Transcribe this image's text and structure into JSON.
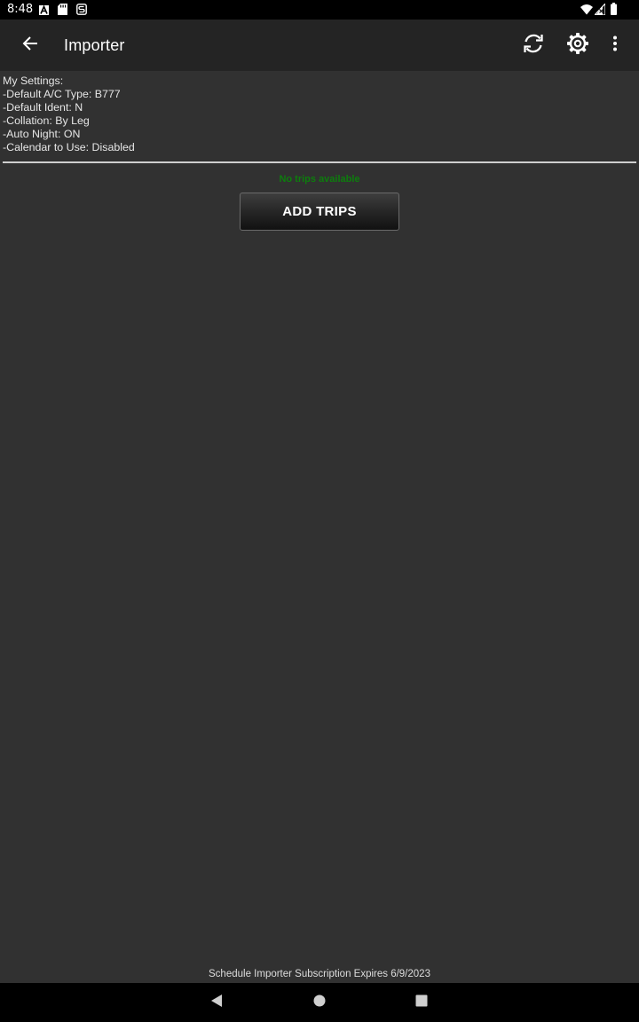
{
  "status_bar": {
    "time": "8:48",
    "left_icons": [
      "font-a-icon",
      "sd-card-icon",
      "sync-s-icon"
    ],
    "right_icons": [
      "wifi-icon",
      "signal-icon",
      "battery-icon"
    ]
  },
  "app_bar": {
    "title": "Importer",
    "back_icon": "arrow-left-icon",
    "actions": [
      "refresh-icon",
      "settings-gear-icon",
      "overflow-menu-icon"
    ]
  },
  "settings": {
    "header": "My Settings:",
    "lines": [
      "-Default A/C Type: B777",
      "-Default Ident: N",
      "-Collation: By Leg",
      "-Auto Night: ON",
      "-Calendar to Use: Disabled"
    ]
  },
  "trips": {
    "empty_message": "No trips available",
    "add_button_label": "ADD TRIPS"
  },
  "footer": {
    "subscription_text": "Schedule Importer Subscription Expires 6/9/2023"
  },
  "nav_bar": {
    "buttons": [
      "back-triangle-icon",
      "home-circle-icon",
      "recents-square-icon"
    ]
  },
  "colors": {
    "background": "#313131",
    "app_bar": "#242424",
    "status_bar": "#000000",
    "empty_message": "#0d7d0d"
  }
}
